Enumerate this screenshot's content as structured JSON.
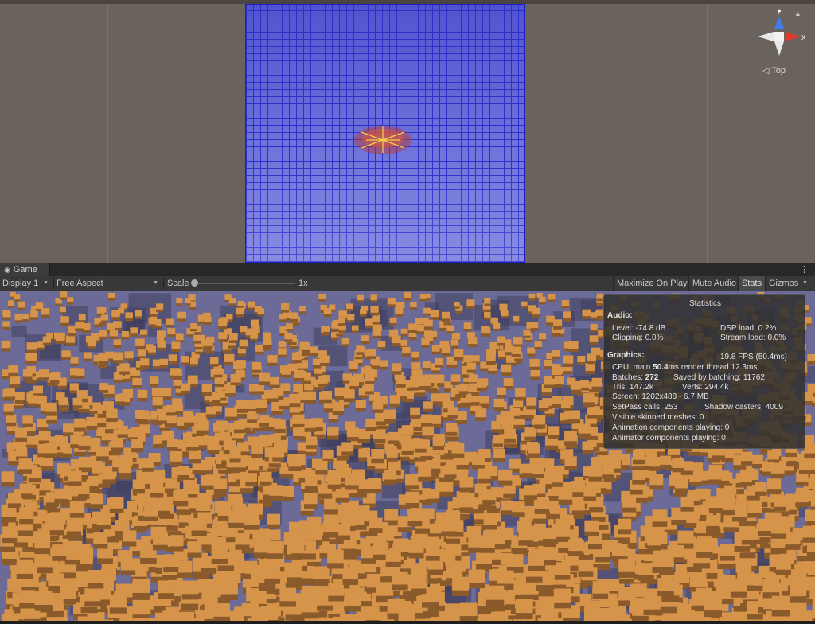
{
  "scene": {
    "gizmo": {
      "axis_z": "Z",
      "axis_x": "X",
      "view_label": "◁ Top",
      "lock_icon": "lock-icon",
      "colors": {
        "z": "#3f7cf0",
        "x": "#e03a2f",
        "center": "#e8e8e8"
      }
    },
    "plane_color": "#3a3ad0",
    "background_color": "#6a635d"
  },
  "game_tab": {
    "label": "Game",
    "icon": "gamepad-icon",
    "menu_icon": "kebab-menu-icon"
  },
  "toolbar": {
    "display_label": "Display 1",
    "aspect_label": "Free Aspect",
    "scale_label": "Scale",
    "scale_value": "1x",
    "maximize_label": "Maximize On Play",
    "mute_label": "Mute Audio",
    "stats_label": "Stats",
    "gizmos_label": "Gizmos"
  },
  "stats": {
    "title": "Statistics",
    "audio_header": "Audio:",
    "level": "Level: -74.8 dB",
    "dsp": "DSP load: 0.2%",
    "clipping": "Clipping: 0.0%",
    "stream": "Stream load: 0.0%",
    "graphics_header": "Graphics:",
    "fps": "19.8 FPS (50.4ms)",
    "cpu_prefix": "CPU: main ",
    "cpu_main": "50.4",
    "cpu_suffix": "ms  render thread 12.3ms",
    "batches_prefix": "Batches: ",
    "batches": "272",
    "saved": "Saved by batching: 11762",
    "tris": "Tris: 147.2k",
    "verts": "Verts: 294.4k",
    "screen": "Screen: 1202x488 - 6.7 MB",
    "setpass": "SetPass calls: 253",
    "shadow": "Shadow casters: 4009",
    "skinned": "Visible skinned meshes: 0",
    "anim": "Animation components playing: 0",
    "animator": "Animator components playing: 0"
  },
  "game_view": {
    "ground_color": "#6c6a96",
    "cube_color": "#d6944a"
  }
}
